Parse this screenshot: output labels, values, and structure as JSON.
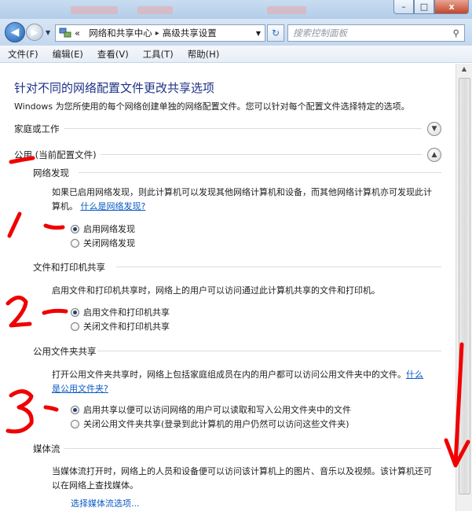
{
  "window": {
    "minimize_label": "–",
    "maximize_label": "□",
    "close_label": "x"
  },
  "address": {
    "prefix": "«",
    "crumbs": [
      "网络和共享中心",
      "高级共享设置"
    ],
    "search_placeholder": "搜索控制面板"
  },
  "menu": [
    "文件(F)",
    "编辑(E)",
    "查看(V)",
    "工具(T)",
    "帮助(H)"
  ],
  "page": {
    "title": "针对不同的网络配置文件更改共享选项",
    "description": "Windows 为您所使用的每个网络创建单独的网络配置文件。您可以针对每个配置文件选择特定的选项。"
  },
  "profiles": {
    "home": "家庭或工作",
    "public": "公用 (当前配置文件)"
  },
  "discovery": {
    "heading": "网络发现",
    "text": "如果已启用网络发现，则此计算机可以发现其他网络计算机和设备，而其他网络计算机亦可发现此计算机。",
    "link": "什么是网络发现?",
    "opt_on": "启用网络发现",
    "opt_off": "关闭网络发现",
    "selected": "on"
  },
  "fileprint": {
    "heading": "文件和打印机共享",
    "text": "启用文件和打印机共享时，网络上的用户可以访问通过此计算机共享的文件和打印机。",
    "opt_on": "启用文件和打印机共享",
    "opt_off": "关闭文件和打印机共享",
    "selected": "on"
  },
  "publicfolder": {
    "heading": "公用文件夹共享",
    "text_a": "打开公用文件夹共享时，网络上包括家庭组成员在内的用户都可以访问公用文件夹中的文件。",
    "link_a": "什么",
    "link_b": "是公用文件夹?",
    "opt_on": "启用共享以便可以访问网络的用户可以读取和写入公用文件夹中的文件",
    "opt_off": "关闭公用文件夹共享(登录到此计算机的用户仍然可以访问这些文件夹)",
    "selected": "on"
  },
  "media": {
    "heading": "媒体流",
    "text": "当媒体流打开时，网络上的人员和设备便可以访问该计算机上的图片、音乐以及视频。该计算机还可以在网络上查找媒体。",
    "link": "选择媒体流选项..."
  },
  "colors": {
    "title_blue": "#1e3287",
    "link_blue": "#0a5bc4",
    "annotation_red": "#f00000"
  }
}
